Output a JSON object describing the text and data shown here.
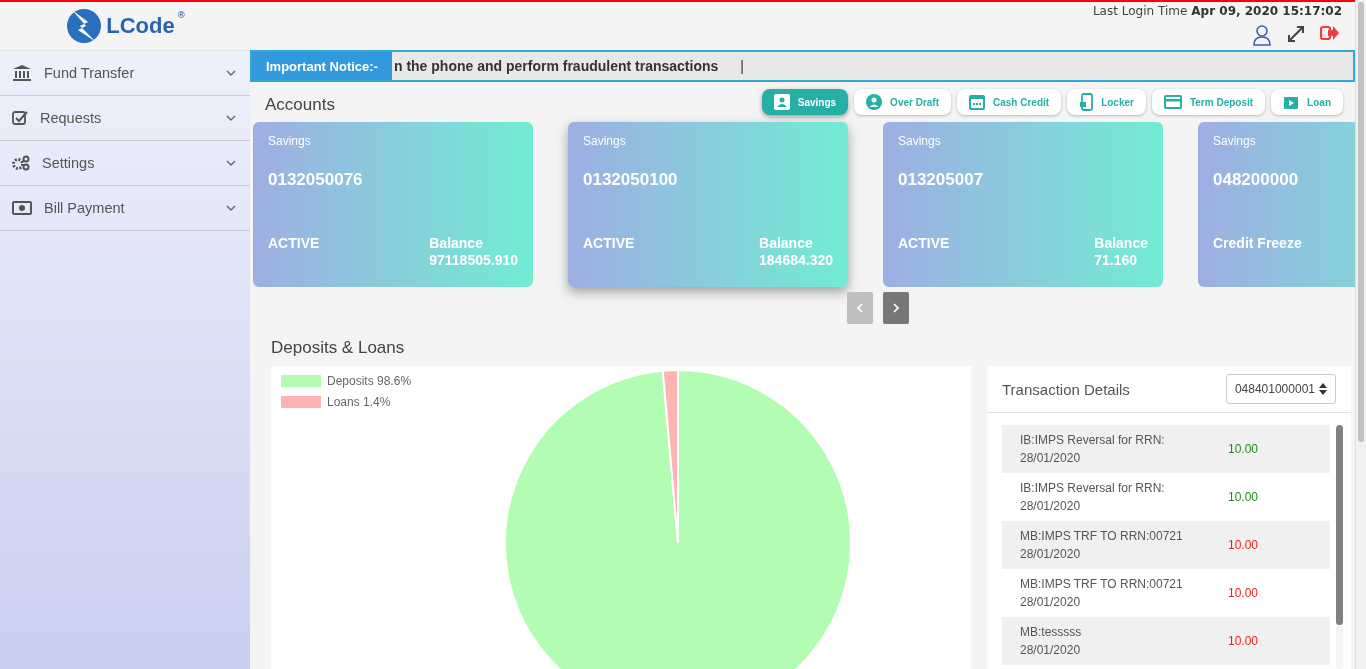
{
  "logo": {
    "name": "LCode",
    "mark": "®"
  },
  "header": {
    "last_login_label": "Last Login Time",
    "last_login_value": "Apr 09, 2020 15:17:02"
  },
  "sidebar": {
    "items": [
      {
        "label": "Fund Transfer",
        "kind": "bank",
        "expanded": false
      },
      {
        "label": "Requests",
        "kind": "check",
        "expanded": false
      },
      {
        "label": "Settings",
        "kind": "gears",
        "expanded": false
      },
      {
        "label": "Bill Payment",
        "kind": "money",
        "expanded": false
      }
    ]
  },
  "notice": {
    "label": "Important Notice:-",
    "text": "n the phone and perform fraudulent transactions",
    "separator": "|"
  },
  "accounts": {
    "title": "Accounts",
    "tabs": [
      {
        "label": "Savings",
        "kind": "person",
        "selected": true
      },
      {
        "label": "Over Draft",
        "kind": "user-circle",
        "selected": false
      },
      {
        "label": "Cash Credit",
        "kind": "calendar",
        "selected": false
      },
      {
        "label": "Locker",
        "kind": "phone-lock",
        "selected": false
      },
      {
        "label": "Term Deposit",
        "kind": "card",
        "selected": false
      },
      {
        "label": "Loan",
        "kind": "bag",
        "selected": false
      }
    ],
    "cards": [
      {
        "type": "Savings",
        "number": "0132050076",
        "status": "ACTIVE",
        "balance_label": "Balance",
        "balance": "97118505.910",
        "selected": false
      },
      {
        "type": "Savings",
        "number": "0132050100",
        "status": "ACTIVE",
        "balance_label": "Balance",
        "balance": "184684.320",
        "selected": true
      },
      {
        "type": "Savings",
        "number": "013205007",
        "status": "ACTIVE",
        "balance_label": "Balance",
        "balance": "71.160",
        "selected": false
      },
      {
        "type": "Savings",
        "number": "048200000",
        "status": "Credit Freeze",
        "selected": false
      }
    ],
    "prev_disabled": true,
    "next_disabled": false
  },
  "deposits_loans": {
    "title": "Deposits & Loans",
    "legend": [
      {
        "percent": "98.6%",
        "color": "#b3fcb3"
      },
      {
        "percent": "1.4%",
        "color": "#ffb3b3"
      }
    ],
    "chart_data": {
      "type": "pie",
      "categories": [
        "Deposits",
        "Loans"
      ],
      "values": [
        98.6,
        1.4
      ]
    }
  },
  "transactions": {
    "title": "Transaction Details",
    "account": "048401000001",
    "rows": [
      {
        "description": "IB:IMPS Reversal for RRN:",
        "date": "28/01/2020",
        "amount": "10.00",
        "kind": "credit"
      },
      {
        "description": "IB:IMPS Reversal for RRN:",
        "date": "28/01/2020",
        "amount": "10.00",
        "kind": "credit"
      },
      {
        "description": "MB:IMPS TRF TO RRN:00721",
        "date": "28/01/2020",
        "amount": "10.00",
        "kind": "debit"
      },
      {
        "description": "MB:IMPS TRF TO RRN:00721",
        "date": "28/01/2020",
        "amount": "10.00",
        "kind": "debit"
      },
      {
        "description": "MB:tesssss",
        "date": "28/01/2020",
        "amount": "10.00",
        "kind": "debit"
      }
    ]
  }
}
